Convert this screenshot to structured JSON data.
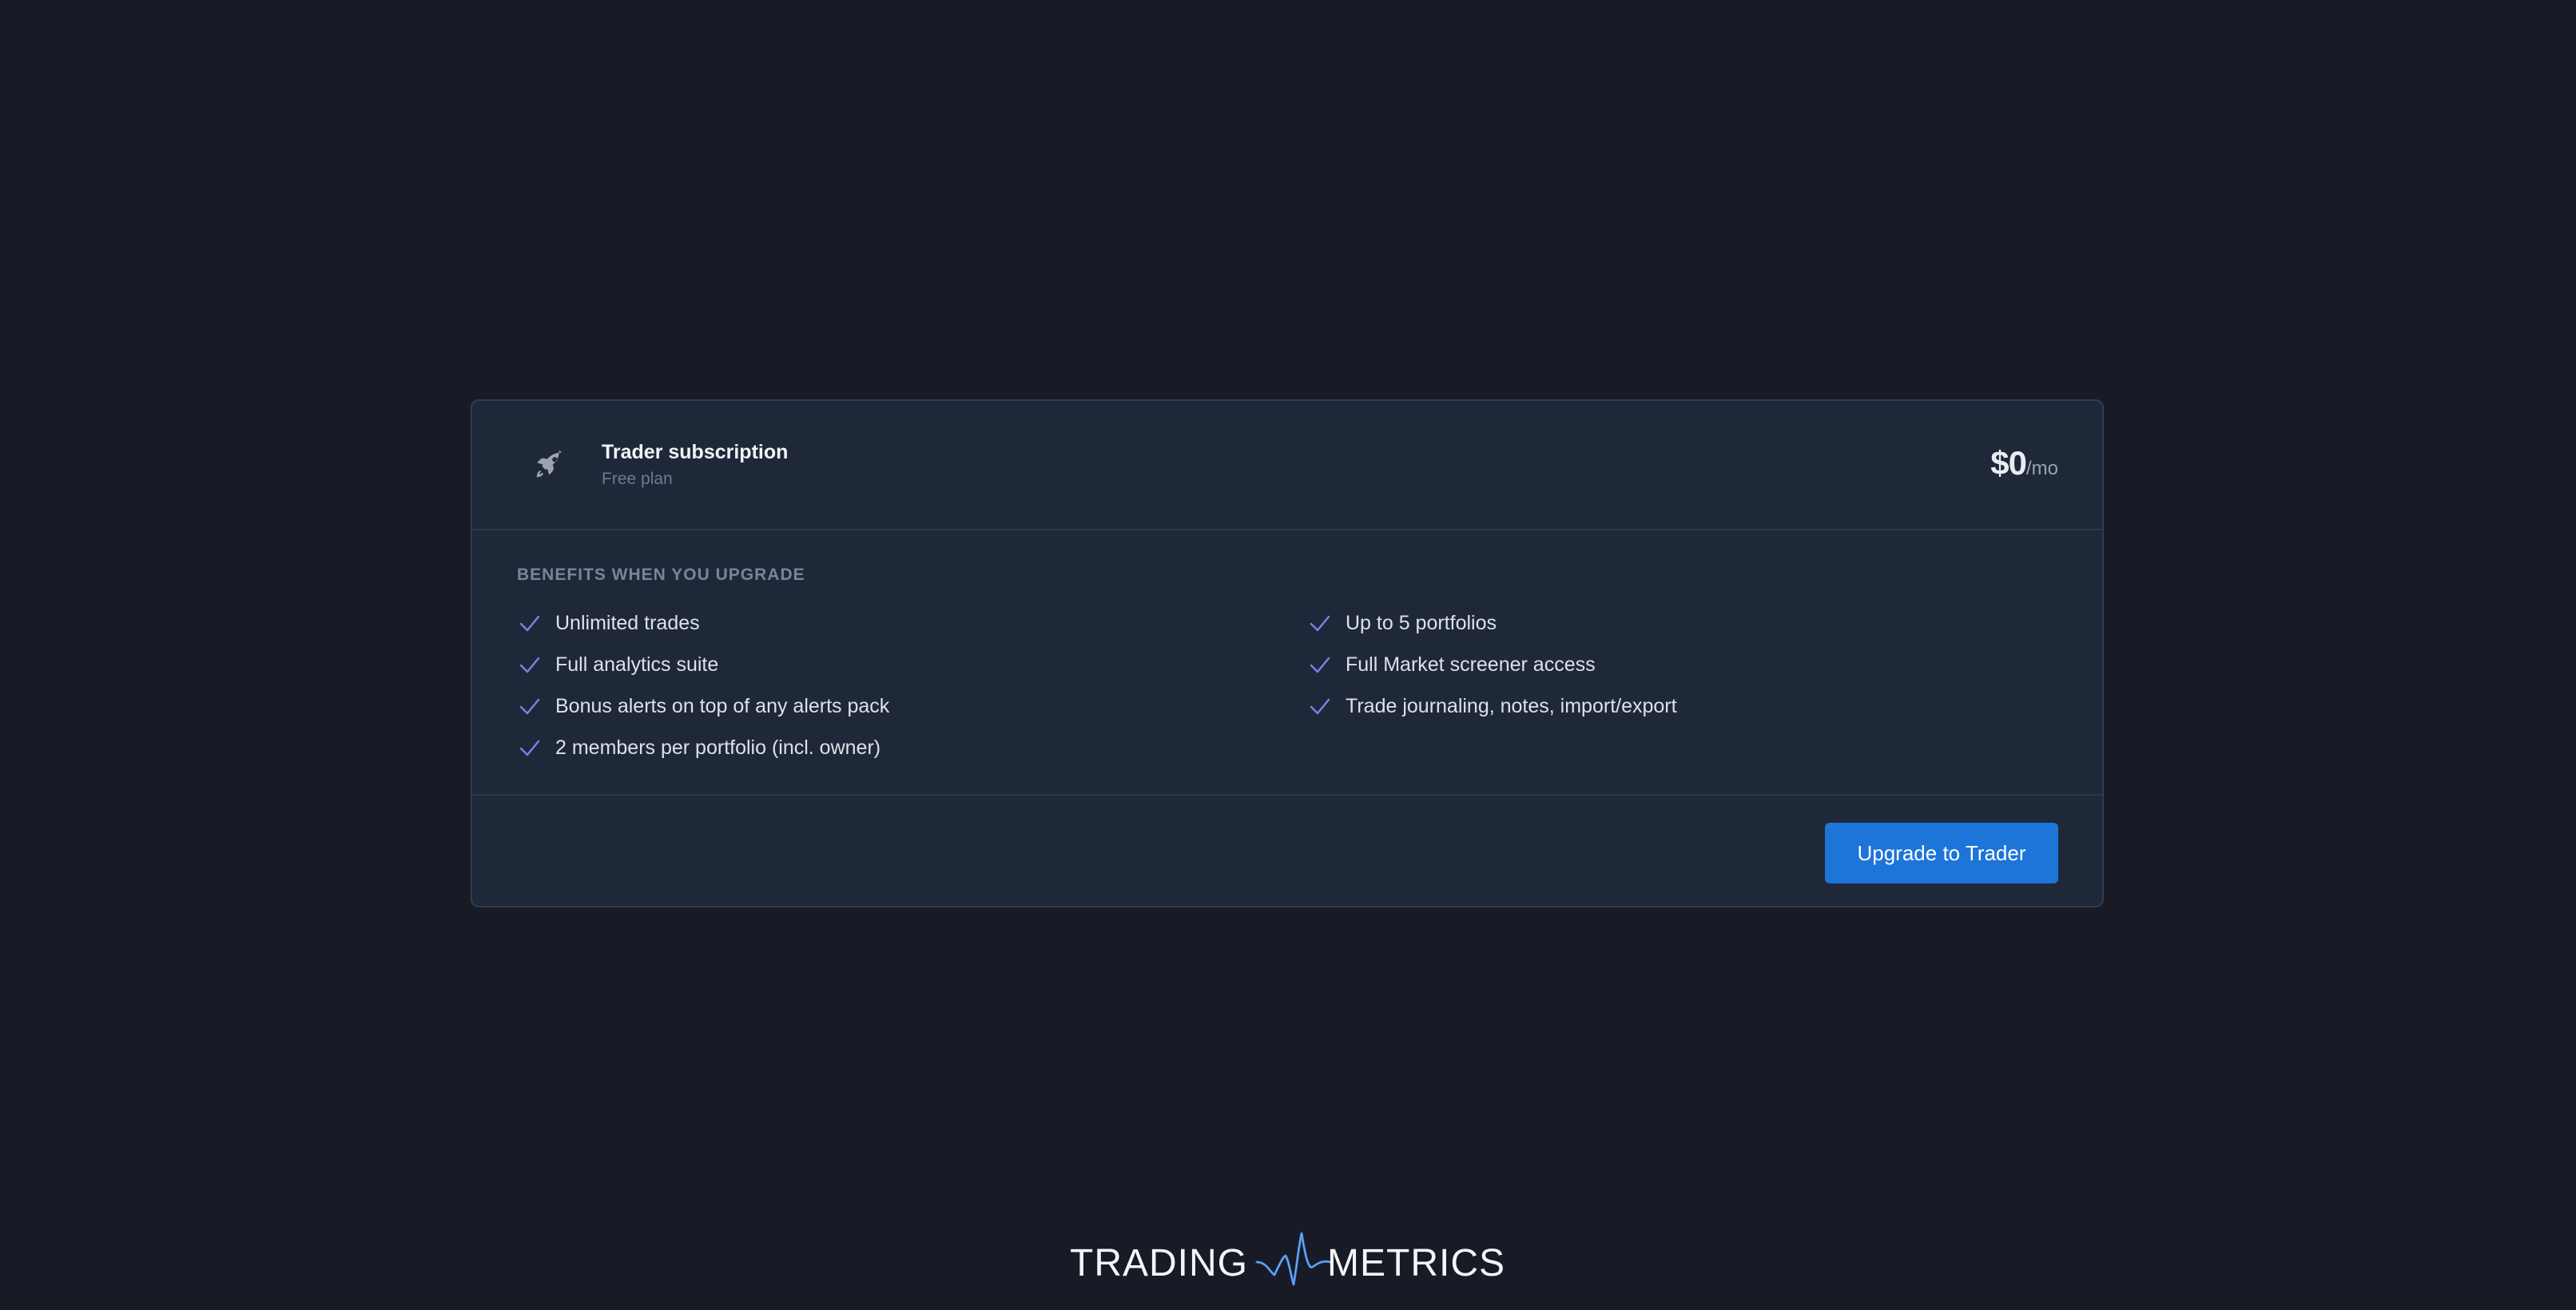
{
  "plan": {
    "title": "Trader subscription",
    "subtitle": "Free plan",
    "price_amount": "$0",
    "price_period": "/mo",
    "icon": "rocket-icon"
  },
  "benefits": {
    "heading": "BENEFITS WHEN YOU UPGRADE",
    "left": [
      "Unlimited trades",
      "Full analytics suite",
      "Bonus alerts on top of any alerts pack",
      "2 members per portfolio (incl. owner)"
    ],
    "right": [
      "Up to 5 portfolios",
      "Full Market screener access",
      "Trade journaling, notes, import/export"
    ],
    "check_icon": "check-icon"
  },
  "actions": {
    "upgrade_label": "Upgrade to Trader"
  },
  "brand": {
    "left": "TRADING",
    "right": "METRICS"
  },
  "colors": {
    "background": "#181b25",
    "card": "#1f2839",
    "accent": "#1d74d9",
    "check": "#7a82e8"
  }
}
